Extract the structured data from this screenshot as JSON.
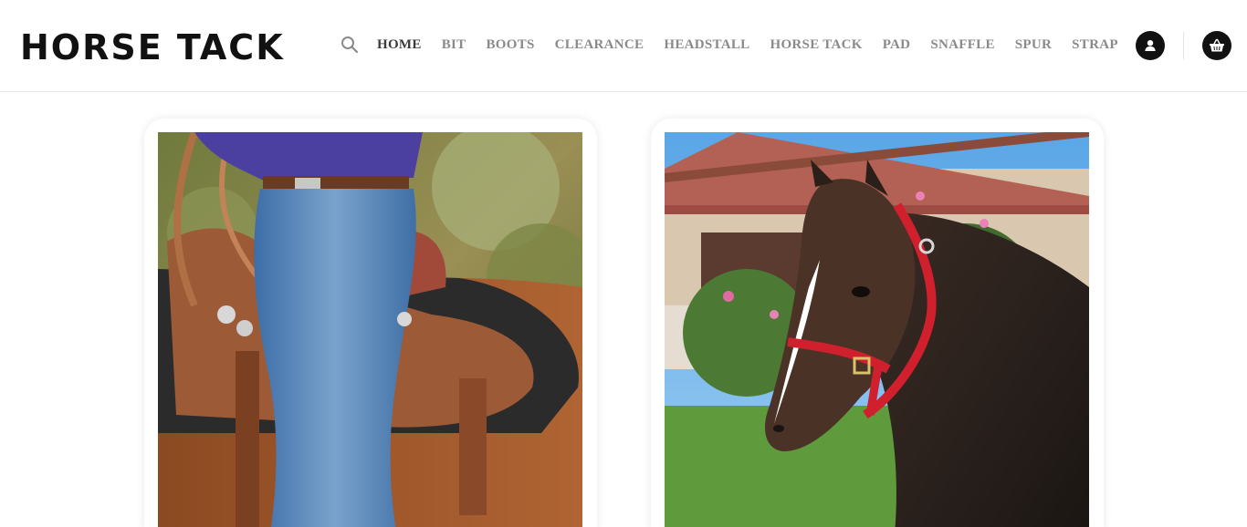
{
  "site": {
    "logo": "HORSE TACK"
  },
  "nav": {
    "search_icon": "search-icon",
    "items": [
      {
        "label": "HOME",
        "active": true
      },
      {
        "label": "BIT",
        "active": false
      },
      {
        "label": "BOOTS",
        "active": false
      },
      {
        "label": "CLEARANCE",
        "active": false
      },
      {
        "label": "HEADSTALL",
        "active": false
      },
      {
        "label": "HORSE TACK",
        "active": false
      },
      {
        "label": "PAD",
        "active": false
      },
      {
        "label": "SNAFFLE",
        "active": false
      },
      {
        "label": "SPUR",
        "active": false
      },
      {
        "label": "STRAP",
        "active": false
      }
    ]
  },
  "header_actions": {
    "account_icon": "user-icon",
    "cart_icon": "basket-icon"
  },
  "products": [
    {
      "image": "rider-in-jeans-on-western-saddle-photo"
    },
    {
      "image": "bay-horse-wearing-red-halter-photo"
    }
  ],
  "colors": {
    "nav_active": "#3a3a3a",
    "nav_inactive": "#8a8a8a",
    "icon_circle": "#111111",
    "halter_red": "#d0202e"
  }
}
